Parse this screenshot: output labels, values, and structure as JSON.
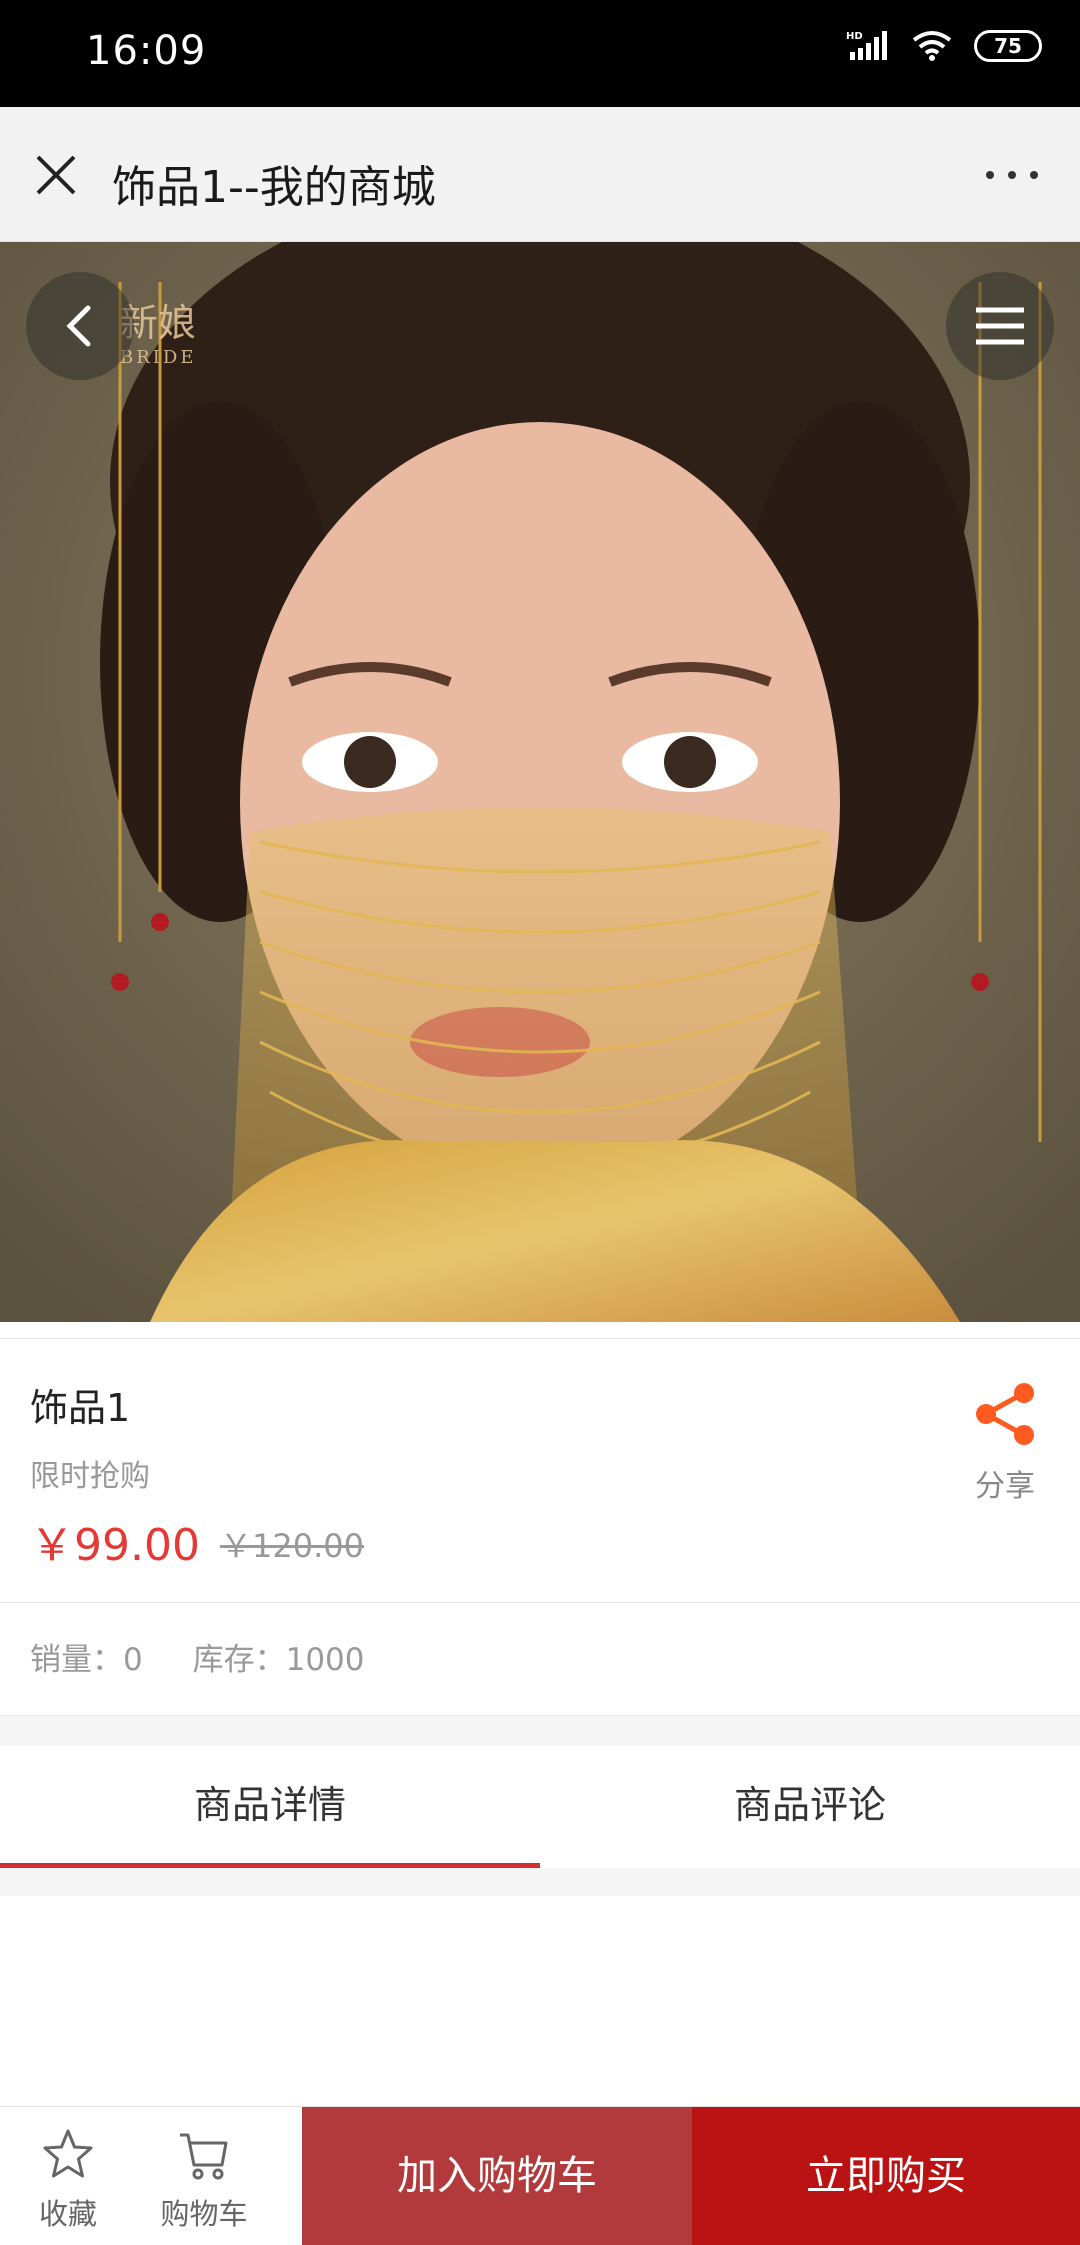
{
  "status_bar": {
    "time": "16:09",
    "battery": "75"
  },
  "title_bar": {
    "title": "饰品1--我的商城"
  },
  "hero": {
    "watermark_cn": "新娘",
    "watermark_en": "BRIDE"
  },
  "product": {
    "name": "饰品1",
    "promo": "限时抢购",
    "price_now": "￥99.00",
    "price_old": "￥120.00",
    "share_label": "分享"
  },
  "stats": {
    "sales": "销量：0",
    "stock": "库存：1000"
  },
  "tabs": [
    {
      "label": "商品详情",
      "active": true
    },
    {
      "label": "商品评论",
      "active": false
    }
  ],
  "bottom_bar": {
    "favorite_label": "收藏",
    "cart_label": "购物车",
    "add_to_cart": "加入购物车",
    "buy_now": "立即购买"
  },
  "colors": {
    "price": "#e53935",
    "tab_indicator": "#d32f2f",
    "add_to_cart_bg": "#b23a3c",
    "buy_now_bg": "#bb1313",
    "share_icon": "#ff5a1f"
  }
}
